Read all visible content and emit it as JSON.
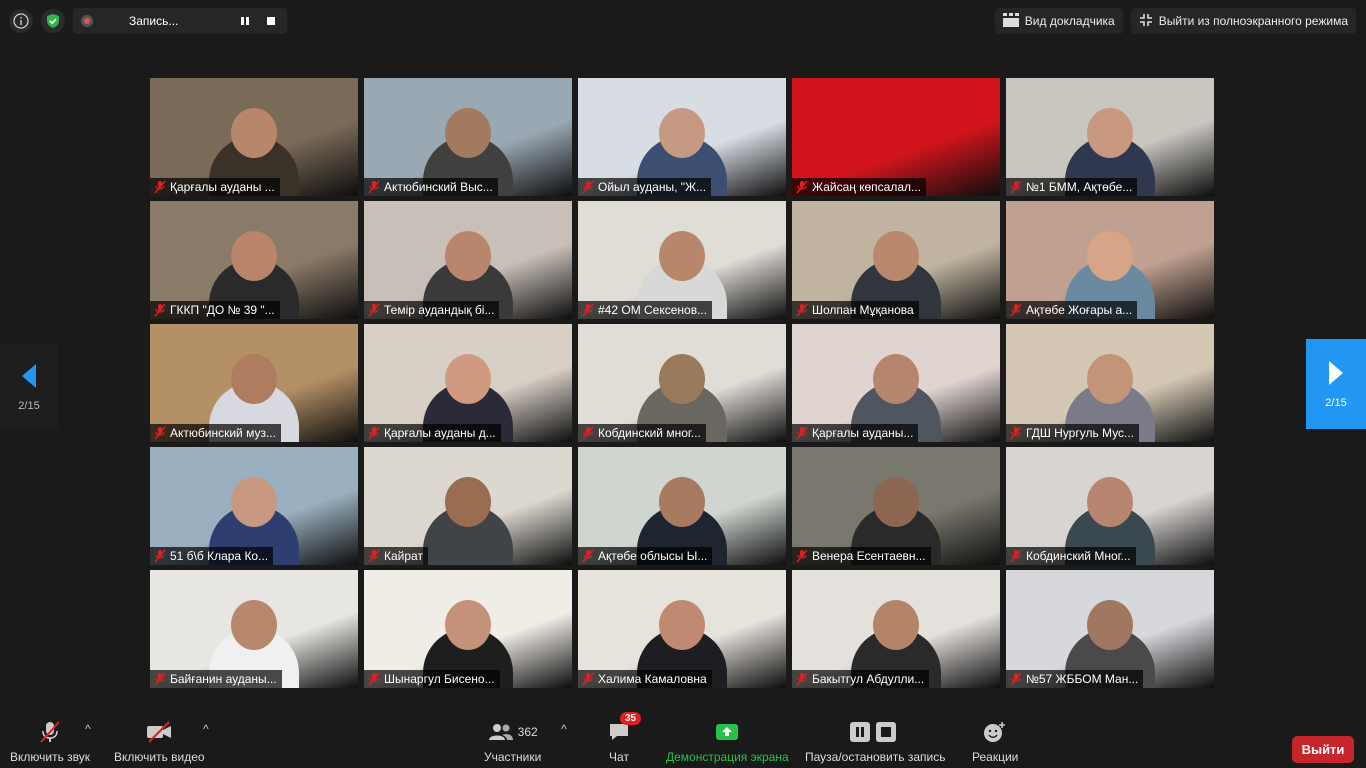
{
  "recording": {
    "label": "Запись..."
  },
  "top_right": {
    "speaker_view": "Вид докладчика",
    "exit_fullscreen": "Выйти из полноэкранного режима"
  },
  "pagination": {
    "left": "2/15",
    "right": "2/15"
  },
  "tiles": [
    {
      "label": "Қарғалы ауданы ...",
      "bg": "#7a6a58",
      "skin": "#b8866a",
      "cloth": "#3a3228"
    },
    {
      "label": "Актюбинский Выс...",
      "bg": "#9aa8b4",
      "skin": "#a27a60",
      "cloth": "#40403e"
    },
    {
      "label": "Ойыл ауданы, \"Ж...",
      "bg": "#d8dde4",
      "skin": "#c69a82",
      "cloth": "#3c4e72"
    },
    {
      "label": "Жайсаң көпсалал...",
      "bg": "#d1141c",
      "skin": "#d1141c",
      "cloth": "#d1141c"
    },
    {
      "label": "№1 БММ, Ақтөбе...",
      "bg": "#c9c6c0",
      "skin": "#c99880",
      "cloth": "#303850"
    },
    {
      "label": "ГККП \"ДО № 39 \"...",
      "bg": "#8a7a68",
      "skin": "#b98468",
      "cloth": "#2a2a2a"
    },
    {
      "label": "Темір аудандық бі...",
      "bg": "#c8bfb8",
      "skin": "#b8866c",
      "cloth": "#3a3a3a"
    },
    {
      "label": "#42 ОМ Сексенов...",
      "bg": "#e0dcd6",
      "skin": "#b8866a",
      "cloth": "#d8d8d8"
    },
    {
      "label": "Шолпан Мұқанова",
      "bg": "#c0b4a0",
      "skin": "#b9876c",
      "cloth": "#30363c"
    },
    {
      "label": "Ақтөбе Жоғары а...",
      "bg": "#c0a090",
      "skin": "#d6a486",
      "cloth": "#6a8aa0"
    },
    {
      "label": "Актюбинский муз...",
      "bg": "#b49066",
      "skin": "#b07c60",
      "cloth": "#d8d8e0"
    },
    {
      "label": "Қарғалы ауданы д...",
      "bg": "#d8cfc6",
      "skin": "#d09a80",
      "cloth": "#2a2a38"
    },
    {
      "label": "Кобдинский мног...",
      "bg": "#e0dcd6",
      "skin": "#9a7a5c",
      "cloth": "#6a6660"
    },
    {
      "label": "Қарғалы ауданы...",
      "bg": "#e0d4d0",
      "skin": "#b6866c",
      "cloth": "#505660"
    },
    {
      "label": "ГДШ Нургуль Мус...",
      "bg": "#d4c8b4",
      "skin": "#c29478",
      "cloth": "#7a7a88"
    },
    {
      "label": "51 б\\б Клара Ко...",
      "bg": "#9ab0c0",
      "skin": "#c99880",
      "cloth": "#2f3e70"
    },
    {
      "label": "Кайрат",
      "bg": "#dcd8d0",
      "skin": "#9a6c50",
      "cloth": "#404448"
    },
    {
      "label": "Ақтөбе облысы Ы...",
      "bg": "#cfd6d0",
      "skin": "#a87a60",
      "cloth": "#1e2430"
    },
    {
      "label": "Венера Есентаевн...",
      "bg": "#7a786e",
      "skin": "#8c6650",
      "cloth": "#2a2a2a"
    },
    {
      "label": "Кобдинский Мног...",
      "bg": "#d8d4d2",
      "skin": "#b88670",
      "cloth": "#3a4850"
    },
    {
      "label": "Байғанин ауданы...",
      "bg": "#e8e6e2",
      "skin": "#b8886c",
      "cloth": "#f0f0f0"
    },
    {
      "label": "Шынаргул Бисено...",
      "bg": "#f0ece6",
      "skin": "#c49278",
      "cloth": "#1e1e1e"
    },
    {
      "label": "Халима Камаловна",
      "bg": "#e6e2dc",
      "skin": "#c08a72",
      "cloth": "#1e1e22"
    },
    {
      "label": "Бакытгул Абдулли...",
      "bg": "#e4e0dc",
      "skin": "#b48468",
      "cloth": "#2a2a2a"
    },
    {
      "label": "№57 ЖББОМ Ман...",
      "bg": "#d6d8dc",
      "skin": "#a07860",
      "cloth": "#4a4a4a"
    }
  ],
  "bottom": {
    "audio": "Включить звук",
    "video": "Включить видео",
    "participants": "Участники",
    "participants_count": "362",
    "chat": "Чат",
    "chat_badge": "35",
    "share": "Демонстрация экрана",
    "record": "Пауза/остановить запись",
    "reactions": "Реакции",
    "leave": "Выйти"
  }
}
